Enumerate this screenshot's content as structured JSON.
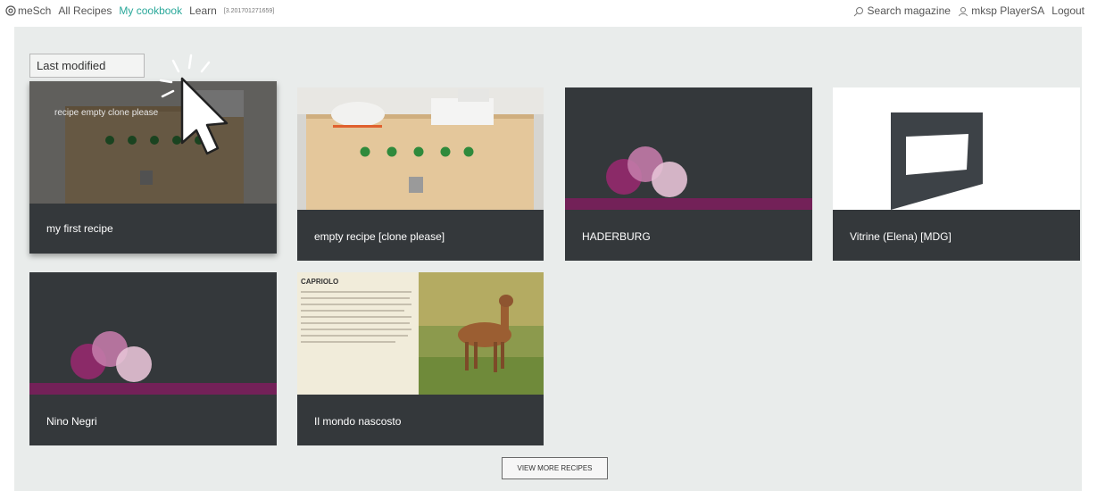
{
  "topbar": {
    "logo_label": "meSch",
    "nav": [
      "All Recipes",
      "My cookbook",
      "Learn"
    ],
    "version": "[3.201701271659]",
    "search_label": "Search magazine",
    "user_label": "mksp PlayerSA",
    "logout_label": "Logout"
  },
  "sort": {
    "selected": "Last modified"
  },
  "recipes": [
    {
      "title": "my first recipe",
      "overlay_text": "recipe empty clone please",
      "image": "wooden-box-photo-dimmed"
    },
    {
      "title": "empty recipe [clone please]",
      "image": "wooden-box-photo"
    },
    {
      "title": "HADERBURG",
      "image": "visitaly-logo"
    },
    {
      "title": "Vitrine (Elena) [MDG]",
      "image": "vitrine-render"
    },
    {
      "title": "Nino Negri",
      "image": "visitaly-logo"
    },
    {
      "title": "Il mondo nascosto",
      "image": "capriolo-deer",
      "image_heading": "CAPRIOLO"
    }
  ],
  "view_more_label": "VIEW MORE RECIPES",
  "colors": {
    "accent": "#2aa89a",
    "card_bg": "#34383b",
    "page_bg": "#e9eceb",
    "brand_purple": "#7a1f5c"
  }
}
